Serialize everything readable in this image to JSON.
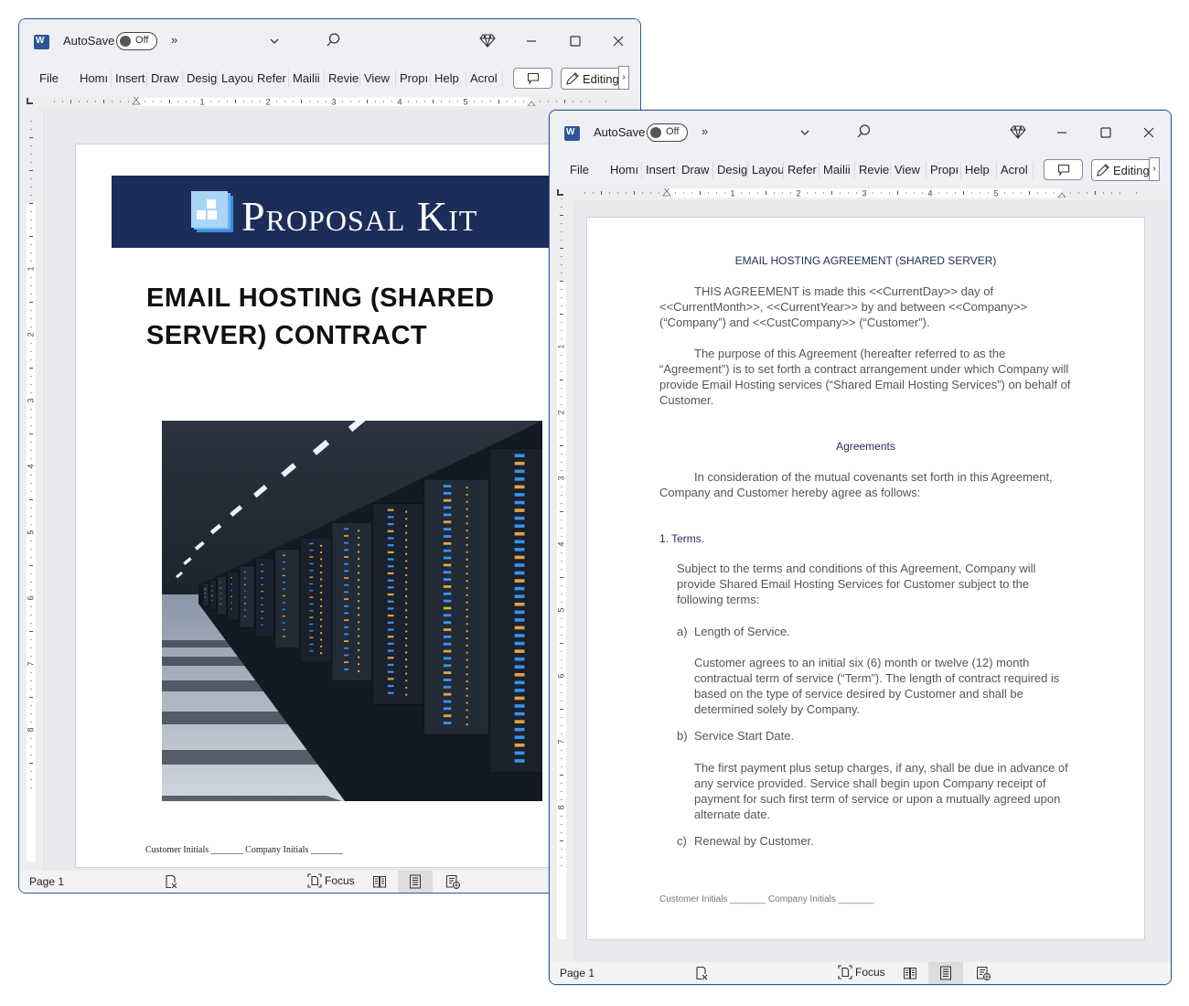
{
  "windows": [
    {
      "id": "left",
      "titlebar": {
        "app_icon": "word-icon",
        "autosave_label": "AutoSave",
        "autosave_state": "Off",
        "more_commands": "»",
        "customize_chevron": "⌄",
        "search_icon": "search-icon",
        "premium_icon": "diamond-icon",
        "window_controls": [
          "minimize",
          "maximize",
          "close"
        ]
      },
      "ribbon_tabs": [
        "File",
        "Homı",
        "Insert",
        "Draw",
        "Desig",
        "Layou",
        "Refer",
        "Mailii",
        "Revie",
        "View",
        "Propı",
        "Help",
        "Acrol"
      ],
      "ribbon_buttons": {
        "comment_icon": "comment-icon",
        "editing_label": "Editing",
        "expand": "›"
      },
      "ruler_numbers": [
        "1",
        "2",
        "3",
        "4",
        "5"
      ],
      "vruler_numbers": [
        "1",
        "2",
        "3",
        "4",
        "5",
        "6",
        "7",
        "8"
      ],
      "document": {
        "banner_brand": "Proposal Kit",
        "cover_title": "EMAIL HOSTING (SHARED SERVER) CONTRACT",
        "image_alt": "Data center server racks with blue and amber lights",
        "initials_line": "Customer Initials  _______ Company Initials _______"
      },
      "statusbar": {
        "page": "Page 1",
        "focus": "Focus"
      }
    },
    {
      "id": "right",
      "titlebar": {
        "app_icon": "word-icon",
        "autosave_label": "AutoSave",
        "autosave_state": "Off",
        "more_commands": "»",
        "customize_chevron": "⌄",
        "search_icon": "search-icon",
        "premium_icon": "diamond-icon",
        "window_controls": [
          "minimize",
          "maximize",
          "close"
        ]
      },
      "ribbon_tabs": [
        "File",
        "Homı",
        "Insert",
        "Draw",
        "Desig",
        "Layou",
        "Refer",
        "Mailii",
        "Revie",
        "View",
        "Propı",
        "Help",
        "Acrol"
      ],
      "ribbon_buttons": {
        "comment_icon": "comment-icon",
        "editing_label": "Editing",
        "expand": "›"
      },
      "ruler_numbers": [
        "1",
        "2",
        "3",
        "4",
        "5"
      ],
      "vruler_numbers": [
        "1",
        "2",
        "3",
        "4",
        "5",
        "6",
        "7",
        "8"
      ],
      "document": {
        "title": "EMAIL HOSTING AGREEMENT (SHARED SERVER)",
        "intro_paragraph": "THIS AGREEMENT is made this <<CurrentDay>> day of <<CurrentMonth>>, <<CurrentYear>> by and between <<Company>> (“Company”) and <<CustCompany>> (“Customer”).",
        "purpose_paragraph": "The purpose of this Agreement (hereafter referred to as the “Agreement”) is to set forth a contract arrangement under which Company will provide Email Hosting services (“Shared Email Hosting Services”) on behalf of Customer.",
        "agreements_heading": "Agreements",
        "consideration_paragraph": "In consideration of the mutual covenants set forth in this Agreement, Company and Customer hereby agree as follows:",
        "section_1_heading": "1. Terms.",
        "section_1_paragraph": "Subject to the terms and conditions of this Agreement, Company will provide Shared Email Hosting Services for Customer subject to the following terms:",
        "items": [
          {
            "marker": "a)",
            "heading": "Length of Service.",
            "body": "Customer agrees to an initial six (6) month or twelve (12) month contractual term of service (“Term”). The length of contract required is based on the type of service desired by Customer and shall be determined solely by Company."
          },
          {
            "marker": "b)",
            "heading": "Service Start Date.",
            "body": "The first payment plus setup charges, if any, shall be due in advance of any service provided. Service shall begin upon Company receipt of payment for such first term of service or upon a mutually agreed upon alternate date."
          },
          {
            "marker": "c)",
            "heading": "Renewal by Customer.",
            "body": ""
          }
        ],
        "initials_line": "Customer Initials  _______ Company Initials _______"
      },
      "statusbar": {
        "page": "Page 1",
        "focus": "Focus"
      }
    }
  ],
  "colors": {
    "window_border": "#2f5597",
    "banner_navy": "#1c2d5a",
    "heading_navy": "#1f2d5a",
    "body_gray": "#555555",
    "word_blue": "#2b579a"
  }
}
